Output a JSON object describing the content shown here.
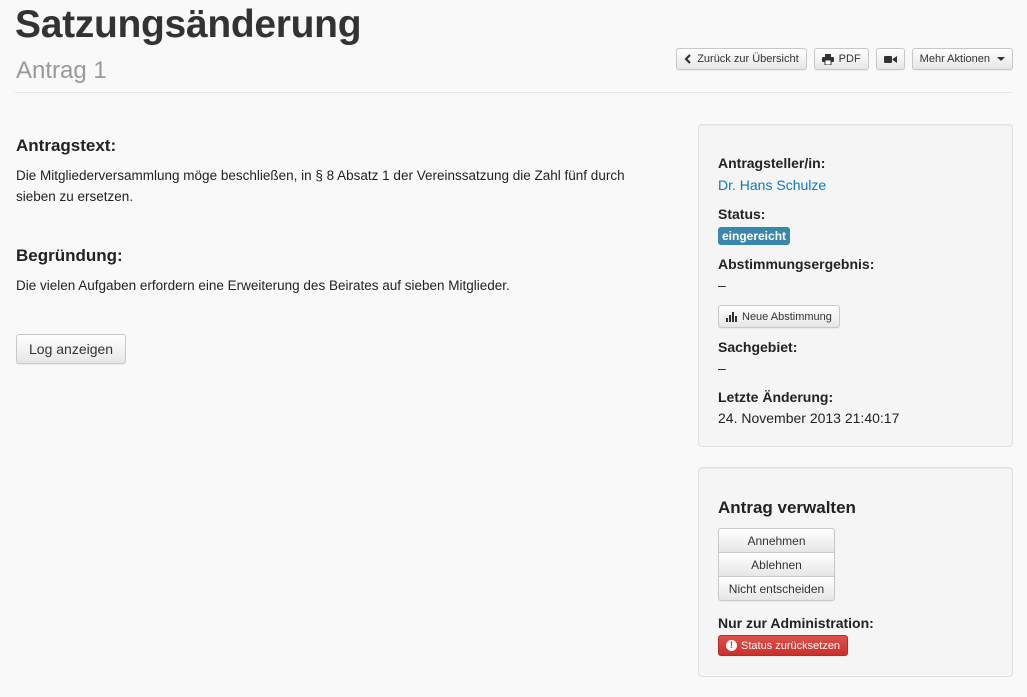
{
  "header": {
    "title": "Satzungsänderung",
    "subtitle": "Antrag 1"
  },
  "toolbar": {
    "back_label": "Zurück zur Übersicht",
    "back_icon": "chevron-left-icon",
    "pdf_label": "PDF",
    "pdf_icon": "print-icon",
    "video_icon": "video-camera-icon",
    "more_label": "Mehr Aktionen",
    "more_icon": "caret-down-icon"
  },
  "main": {
    "motion_heading": "Antragstext:",
    "motion_text": "Die Mitgliederversammlung möge beschließen, in § 8 Absatz 1 der Vereinssatzung die Zahl fünf durch sieben zu ersetzen.",
    "reason_heading": "Begründung:",
    "reason_text": "Die vielen Aufgaben erfordern eine Erweiterung des Beirates auf sieben Mitglieder.",
    "log_button": "Log anzeigen"
  },
  "info_panel": {
    "submitter_label": "Antragsteller/in:",
    "submitter_name": "Dr. Hans Schulze",
    "status_label": "Status:",
    "status_value": "eingereicht",
    "status_color": "#3a87ad",
    "vote_result_label": "Abstimmungsergebnis:",
    "vote_result_value": "–",
    "new_vote_button": "Neue Abstimmung",
    "new_vote_icon": "bar-chart-icon",
    "subject_label": "Sachgebiet:",
    "subject_value": "–",
    "last_change_label": "Letzte Änderung:",
    "last_change_value": "24. November 2013 21:40:17"
  },
  "manage_panel": {
    "title": "Antrag verwalten",
    "actions": [
      "Annehmen",
      "Ablehnen",
      "Nicht entscheiden"
    ],
    "admin_label": "Nur zur Administration:",
    "reset_button": "Status zurücksetzen",
    "reset_icon": "exclamation-circle-icon",
    "danger_color": "#c9302c"
  }
}
